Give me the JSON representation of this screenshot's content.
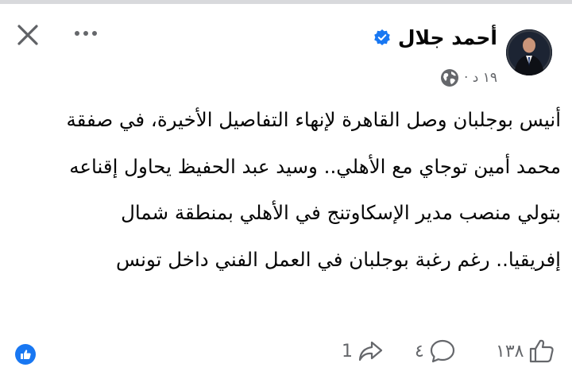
{
  "post": {
    "author": "أحمد جلال",
    "verified": true,
    "timestamp": "١٩ د ·",
    "audience_icon": "globe-icon",
    "body": "أنيس بوجلبان وصل القاهرة لإنهاء التفاصيل الأخيرة، في صفقة محمد أمين توجاي مع الأهلي.. وسيد عبد الحفيظ يحاول إقناعه بتولي منصب مدير الإسكاوتنج في الأهلي بمنطقة شمال إفريقيا.. رغم رغبة بوجلبان في العمل الفني داخل تونس"
  },
  "header": {
    "close_icon": "close-icon",
    "more_icon": "more-icon"
  },
  "footer": {
    "like_count": "١٣٨",
    "comment_count": "٤",
    "share_count": "1",
    "reaction_icon": "like-reaction-icon"
  },
  "colors": {
    "accent": "#1877f2",
    "muted": "#65676b",
    "text": "#050505",
    "divider": "#d8d9dc"
  }
}
